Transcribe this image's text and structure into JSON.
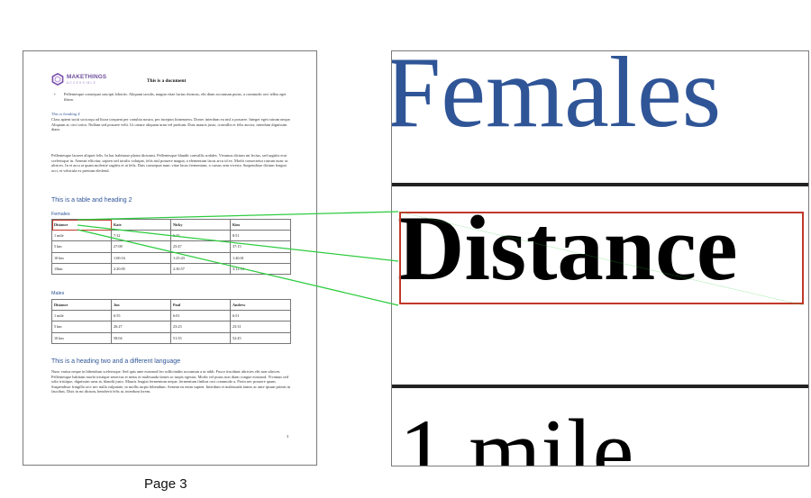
{
  "document": {
    "logo": {
      "brand": "MAKETHINGS",
      "tagline": "ACCESSIBLE"
    },
    "title": "This is a document",
    "bullet_text": "Pellentesque consequat suscipit lobortis. Aliquam iaculis, magna vitae luctus rhoncus, elit diam accumsan purus, a commodo orci tellus eget libero.",
    "heading4": "This is heading 4",
    "para1": "Class aptent taciti sociosqu ad litora torquent per conubia nostra, per inceptos himenaeos. Donec interdum eu nisl a posuere. Integer eget rutrum neque. Aliquam ac orci tortor. Nullam sed posuere velit. Ut ornare aliquam urna vel pretium. Duis mauris justo, convallis et felis auctor, interdum dignissim diam.",
    "para2": "Pellentesque laoreet aliquet felis. In hac habitasse platea dictumst. Pellentesque blandit convallis sodales. Vivamus dictum mi lectus, sed sagittis erat scelerisque in. Aenean efficitur, sapien sed iaculis volutpat, felis nisl posuere magna, a elementum lacus arcu id ex. Morbi consectetur rutrum nunc ac ultrices. In et arcu at quam molestie sagittis et at felis. Duis consequat nunc vitae lacus fermentum, a cursus sem viverra. Suspendisse dictum feugiat orci, et vehicula ex pretium eleifend.",
    "heading2_table": "This is a table and heading 2",
    "females": {
      "caption": "Females",
      "headers": [
        "Distance",
        "Kate",
        "Nicky",
        "Kim"
      ],
      "rows": [
        [
          "1 mile",
          "7:32",
          "6:43",
          "8:51"
        ],
        [
          "5 km",
          "27:08",
          "25:47",
          "37:15"
        ],
        [
          "10 km",
          "1:00:16",
          "1:25:43",
          "1:46:01"
        ],
        [
          "15km",
          "2:20:05",
          "2:30:57",
          "3:12:34"
        ]
      ]
    },
    "males": {
      "caption": "Males",
      "headers": [
        "Distance",
        "Jon",
        "Paul",
        "Andrew"
      ],
      "rows": [
        [
          "1 mile",
          "6:55",
          "6:01",
          "6:51"
        ],
        [
          "5 km",
          "26:27",
          "23:23",
          "23:31"
        ],
        [
          "10 km",
          "58:04",
          "51:35",
          "52:45"
        ]
      ]
    },
    "heading2_lang": "This is a heading two and a different language",
    "para3": "Nunc varius neque in bibendum scelerisque. Sed quis ante euismod leo sollicitudin accumsan a ut nibh. Fusce tincidunt ultricies elit non ultrices. Pellentesque habitant morbi tristique senectus et netus et malesuada fames ac turpis egestas. Morbi vel purus non diam congue euismod. Vivamus sed odio tristique, dignissim urna at, blandit justo. Mauris feugiat fermentum neque, fermentum finibus orci commodo a. Proin nec posuere quam. Suspendisse fringilla orci nec nulla vulputate, ut mollis turpis bibendum. Aenean eu enim sapien. Interdum et malesuada fames ac ante ipsum primis in faucibus. Duis in mi dictum, hendrerit felis at, interdum lorem.",
    "page_number": "3"
  },
  "caption": "Page 3",
  "zoom": {
    "top_text": "Females",
    "highlight_text": "Distance",
    "bottom_text": "1 mile"
  },
  "colors": {
    "heading": "#2f5597",
    "highlight": "#c0392b",
    "connector": "#2ecc40"
  }
}
